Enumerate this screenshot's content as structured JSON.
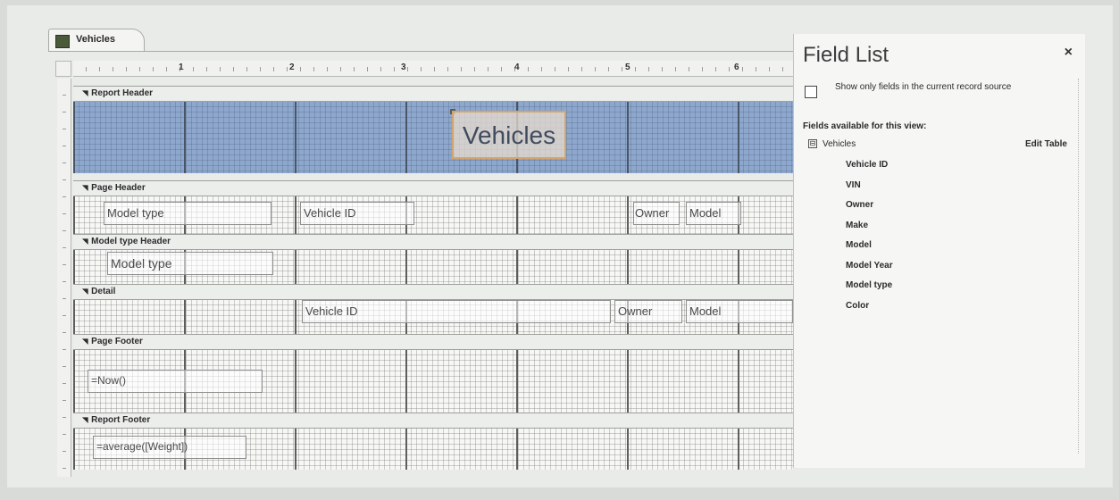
{
  "window": {
    "tab_label": "Vehicles"
  },
  "ruler": {
    "marks": [
      "1",
      "2",
      "3",
      "4",
      "5",
      "6"
    ]
  },
  "sections": {
    "report_header": "Report Header",
    "page_header": "Page Header",
    "group_header": "Model type Header",
    "detail": "Detail",
    "page_footer": "Page Footer",
    "report_footer": "Report Footer"
  },
  "controls": {
    "report_title": "Vehicles",
    "ph_model_type": "Model type",
    "ph_vehicle_id": "Vehicle ID",
    "ph_owner": "Owner",
    "ph_model": "Model",
    "gh_model_type": "Model type",
    "det_vehicle_id": "Vehicle ID",
    "det_owner": "Owner",
    "det_model": "Model",
    "pf_now": "=Now()",
    "rf_average": "=average([Weight])"
  },
  "field_list": {
    "title": "Field List",
    "close": "×",
    "show_only": "Show only fields in the current record source",
    "available": "Fields available for this view:",
    "source_toggle": "⊟",
    "source": "Vehicles",
    "edit_table": "Edit Table",
    "fields": [
      "Vehicle ID",
      "VIN",
      "Owner",
      "Make",
      "Model",
      "Model Year",
      "Model type",
      "Color"
    ]
  }
}
